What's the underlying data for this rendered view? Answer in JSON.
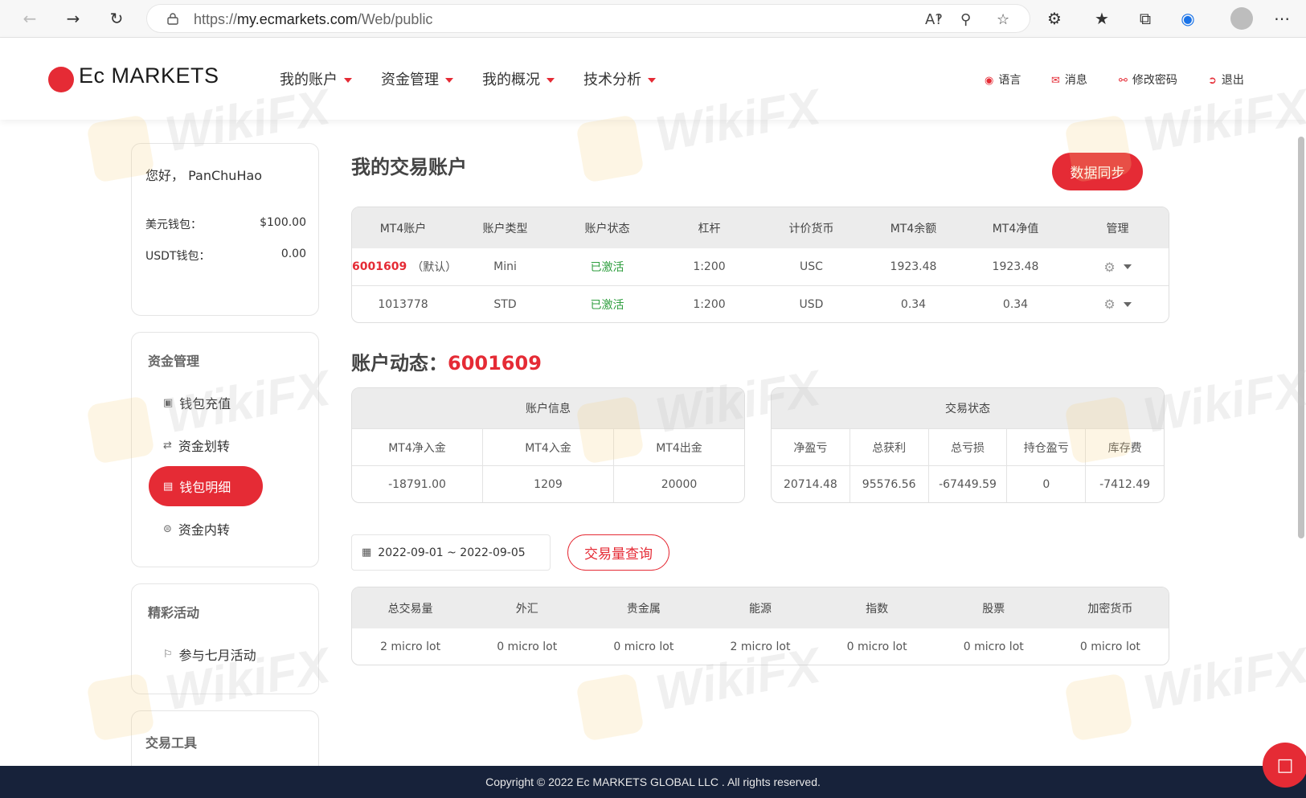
{
  "browser": {
    "url_prefix": "https://",
    "url_host": "my.ecmarkets.com",
    "url_path": "/Web/public"
  },
  "header": {
    "logo_text": "Ec MARKETS",
    "nav": [
      "我的账户",
      "资金管理",
      "我的概况",
      "技术分析"
    ],
    "links": {
      "language": "语言",
      "messages": "消息",
      "change_password": "修改密码",
      "logout": "退出"
    }
  },
  "watermark": "WikiFX",
  "sidebar": {
    "greeting_prefix": "您好，",
    "username": "PanChuHao",
    "wallets": [
      {
        "label": "美元钱包：",
        "value": "$100.00"
      },
      {
        "label": "USDT钱包：",
        "value": "0.00"
      }
    ],
    "fund_title": "资金管理",
    "fund_items": [
      {
        "label": "钱包充值",
        "icon": "wallet-icon"
      },
      {
        "label": "资金划转",
        "icon": "transfer-icon"
      },
      {
        "label": "钱包明细",
        "icon": "document-icon"
      },
      {
        "label": "资金内转",
        "icon": "exchange-icon"
      }
    ],
    "activity_title": "精彩活动",
    "activity_items": [
      {
        "label": "参与七月活动",
        "icon": "flag-icon"
      }
    ],
    "tools_title": "交易工具"
  },
  "accounts": {
    "title": "我的交易账户",
    "sync_label": "数据同步",
    "headers": [
      "MT4账户",
      "账户类型",
      "账户状态",
      "杠杆",
      "计价货币",
      "MT4余额",
      "MT4净值",
      "管理"
    ],
    "rows": [
      {
        "account": "6001609",
        "default_tag": "（默认）",
        "type": "Mini",
        "status": "已激活",
        "leverage": "1:200",
        "currency": "USC",
        "balance": "1923.48",
        "equity": "1923.48"
      },
      {
        "account": "1013778",
        "default_tag": "",
        "type": "STD",
        "status": "已激活",
        "leverage": "1:200",
        "currency": "USD",
        "balance": "0.34",
        "equity": "0.34"
      }
    ]
  },
  "dynamics": {
    "title_prefix": "账户动态：",
    "account": "6001609",
    "info_title": "账户信息",
    "info_headers": [
      "MT4净入金",
      "MT4入金",
      "MT4出金"
    ],
    "info_values": [
      "-18791.00",
      "1209",
      "20000"
    ],
    "trade_title": "交易状态",
    "trade_headers": [
      "净盈亏",
      "总获利",
      "总亏损",
      "持仓盈亏",
      "库存费"
    ],
    "trade_values": [
      "20714.48",
      "95576.56",
      "-67449.59",
      "0",
      "-7412.49"
    ]
  },
  "volume": {
    "date_range": "2022-09-01 ~ 2022-09-05",
    "query_label": "交易量查询",
    "headers": [
      "总交易量",
      "外汇",
      "贵金属",
      "能源",
      "指数",
      "股票",
      "加密货币"
    ],
    "values": [
      "2 micro lot",
      "0 micro lot",
      "0 micro lot",
      "2 micro lot",
      "0 micro lot",
      "0 micro lot",
      "0 micro lot"
    ]
  },
  "footer": {
    "copyright": "Copyright © 2022 Ec MARKETS GLOBAL LLC . All rights reserved."
  }
}
